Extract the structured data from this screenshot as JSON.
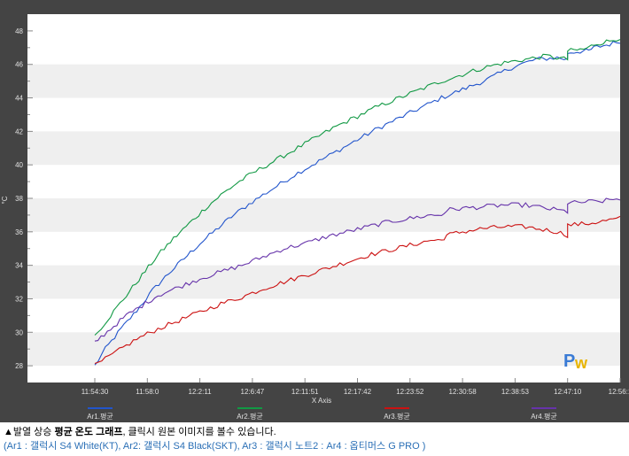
{
  "chart_data": {
    "type": "line",
    "ylabel": "°C",
    "xlabel": "X Axis",
    "ylim": [
      27,
      49
    ],
    "yticks": [
      28,
      30,
      32,
      34,
      36,
      38,
      40,
      42,
      44,
      46,
      48
    ],
    "x_tick_labels": [
      "11:54:30",
      "11:58:0",
      "12:2:11",
      "12:6:47",
      "12:11:51",
      "12:17:42",
      "12:23:52",
      "12:30:58",
      "12:38:53",
      "12:47:10",
      "12:56:1"
    ],
    "grid": true,
    "legend_position": "bottom",
    "series": [
      {
        "name": "Ar1.평균",
        "color": "#2255cc",
        "points": [
          [
            0,
            28.0
          ],
          [
            0.02,
            29.0
          ],
          [
            0.05,
            30.2
          ],
          [
            0.08,
            31.3
          ],
          [
            0.11,
            32.5
          ],
          [
            0.14,
            33.5
          ],
          [
            0.17,
            34.4
          ],
          [
            0.2,
            35.3
          ],
          [
            0.23,
            36.1
          ],
          [
            0.26,
            36.9
          ],
          [
            0.3,
            37.8
          ],
          [
            0.34,
            38.6
          ],
          [
            0.38,
            39.4
          ],
          [
            0.42,
            40.1
          ],
          [
            0.46,
            40.8
          ],
          [
            0.5,
            41.5
          ],
          [
            0.54,
            42.2
          ],
          [
            0.58,
            42.8
          ],
          [
            0.62,
            43.4
          ],
          [
            0.66,
            44.0
          ],
          [
            0.7,
            44.5
          ],
          [
            0.74,
            45.0
          ],
          [
            0.76,
            45.3
          ],
          [
            0.8,
            45.9
          ],
          [
            0.84,
            46.3
          ],
          [
            0.88,
            46.4
          ],
          [
            0.9,
            46.3
          ],
          [
            0.9,
            46.7
          ],
          [
            0.93,
            46.8
          ],
          [
            0.94,
            46.8
          ],
          [
            0.95,
            47.0
          ],
          [
            0.98,
            47.2
          ],
          [
            1.0,
            47.4
          ]
        ]
      },
      {
        "name": "Ar2.평균",
        "color": "#119944",
        "points": [
          [
            0,
            29.8
          ],
          [
            0.03,
            31.0
          ],
          [
            0.06,
            32.2
          ],
          [
            0.09,
            33.4
          ],
          [
            0.12,
            34.6
          ],
          [
            0.15,
            35.6
          ],
          [
            0.18,
            36.5
          ],
          [
            0.21,
            37.4
          ],
          [
            0.24,
            38.2
          ],
          [
            0.27,
            38.9
          ],
          [
            0.3,
            39.5
          ],
          [
            0.34,
            40.2
          ],
          [
            0.38,
            40.9
          ],
          [
            0.42,
            41.6
          ],
          [
            0.46,
            42.3
          ],
          [
            0.5,
            42.9
          ],
          [
            0.54,
            43.5
          ],
          [
            0.58,
            44.0
          ],
          [
            0.62,
            44.5
          ],
          [
            0.66,
            45.0
          ],
          [
            0.7,
            45.4
          ],
          [
            0.74,
            45.8
          ],
          [
            0.78,
            46.1
          ],
          [
            0.82,
            46.3
          ],
          [
            0.86,
            46.5
          ],
          [
            0.88,
            46.4
          ],
          [
            0.9,
            46.3
          ],
          [
            0.9,
            46.8
          ],
          [
            0.93,
            46.9
          ],
          [
            0.94,
            47.0
          ],
          [
            0.95,
            47.2
          ],
          [
            0.98,
            47.4
          ],
          [
            1.0,
            47.6
          ]
        ]
      },
      {
        "name": "Ar3.평균",
        "color": "#cc1111",
        "points": [
          [
            0,
            28.0
          ],
          [
            0.04,
            28.8
          ],
          [
            0.08,
            29.6
          ],
          [
            0.12,
            30.2
          ],
          [
            0.16,
            30.7
          ],
          [
            0.2,
            31.2
          ],
          [
            0.24,
            31.7
          ],
          [
            0.28,
            32.1
          ],
          [
            0.32,
            32.6
          ],
          [
            0.36,
            33.0
          ],
          [
            0.4,
            33.4
          ],
          [
            0.44,
            33.8
          ],
          [
            0.48,
            34.2
          ],
          [
            0.52,
            34.6
          ],
          [
            0.56,
            34.9
          ],
          [
            0.6,
            35.2
          ],
          [
            0.64,
            35.5
          ],
          [
            0.66,
            35.5
          ],
          [
            0.67,
            35.8
          ],
          [
            0.7,
            36.0
          ],
          [
            0.74,
            36.2
          ],
          [
            0.78,
            36.3
          ],
          [
            0.82,
            36.3
          ],
          [
            0.86,
            36.1
          ],
          [
            0.88,
            36.0
          ],
          [
            0.9,
            35.8
          ],
          [
            0.9,
            36.4
          ],
          [
            0.94,
            36.5
          ],
          [
            0.96,
            36.6
          ],
          [
            0.98,
            36.7
          ],
          [
            1.0,
            36.8
          ]
        ]
      },
      {
        "name": "Ar4.평균",
        "color": "#6633aa",
        "points": [
          [
            0,
            29.4
          ],
          [
            0.03,
            30.2
          ],
          [
            0.06,
            31.0
          ],
          [
            0.09,
            31.6
          ],
          [
            0.12,
            32.2
          ],
          [
            0.16,
            32.7
          ],
          [
            0.2,
            33.2
          ],
          [
            0.24,
            33.6
          ],
          [
            0.28,
            34.0
          ],
          [
            0.32,
            34.5
          ],
          [
            0.36,
            35.0
          ],
          [
            0.4,
            35.3
          ],
          [
            0.44,
            35.7
          ],
          [
            0.48,
            36.0
          ],
          [
            0.52,
            36.3
          ],
          [
            0.56,
            36.6
          ],
          [
            0.6,
            36.8
          ],
          [
            0.64,
            37.0
          ],
          [
            0.66,
            37.0
          ],
          [
            0.67,
            37.3
          ],
          [
            0.7,
            37.4
          ],
          [
            0.74,
            37.5
          ],
          [
            0.78,
            37.6
          ],
          [
            0.82,
            37.6
          ],
          [
            0.86,
            37.4
          ],
          [
            0.88,
            37.3
          ],
          [
            0.9,
            37.2
          ],
          [
            0.9,
            37.7
          ],
          [
            0.94,
            37.8
          ],
          [
            0.96,
            37.8
          ],
          [
            0.98,
            37.9
          ],
          [
            1.0,
            38.0
          ]
        ]
      }
    ]
  },
  "caption": {
    "line1_prefix": "▲발열 상승 ",
    "line1_bold": "평균 온도 그래프",
    "line1_suffix": ", 클릭시 원본 이미지를 볼수 있습니다.",
    "line2": "(Ar1 : 갤럭시 S4 White(KT), Ar2: 갤럭시 S4 Black(SKT), Ar3 : 갤럭시 노트2 : Ar4 : 옵티머스 G PRO )"
  }
}
